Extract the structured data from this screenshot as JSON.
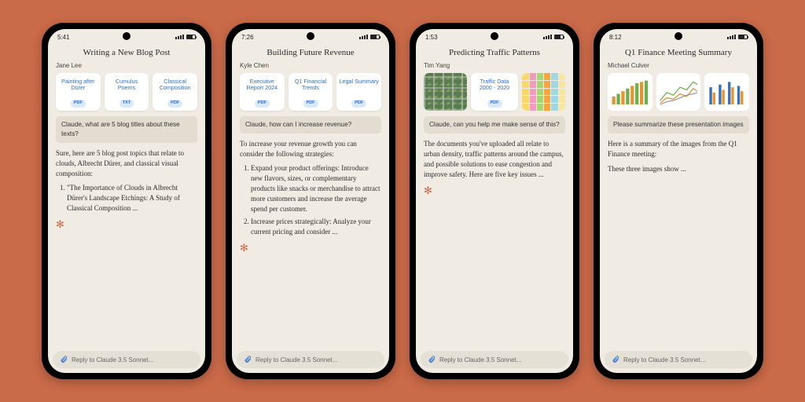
{
  "reply_placeholder": "Reply to Claude 3.5 Sonnet...",
  "phones": [
    {
      "time": "5:41",
      "title": "Writing a New Blog Post",
      "author": "Jane Lee",
      "attachments": [
        {
          "label": "Painting after Dürer",
          "badge": "PDF"
        },
        {
          "label": "Cumulus Poems",
          "badge": "TXT"
        },
        {
          "label": "Classical Composition",
          "badge": "PDF"
        }
      ],
      "user_msg": "Claude, what are 5 blog titles about these texts?",
      "resp_intro": "Sure, here are 5 blog post topics that relate to clouds, Albrecht Dürer, and classical visual composition:",
      "resp_item1": "\"The Importance of Clouds in Albrecht Dürer's Landscape Etchings: A Study of Classical Composition ..."
    },
    {
      "time": "7:26",
      "title": "Building Future Revenue",
      "author": "Kyle Chen",
      "attachments": [
        {
          "label": "Executive Report 2024",
          "badge": "PDF"
        },
        {
          "label": "Q1 Financial Trends",
          "badge": "PDF"
        },
        {
          "label": "Legal Summary",
          "badge": "PDF"
        }
      ],
      "user_msg": "Claude, how can I increase revenue?",
      "resp_intro": "To increase your revenue growth you can consider the following strategies:",
      "resp_item1": "Expand your product offerings: Introduce new flavors, sizes, or complementary products like snacks or merchandise to attract more customers and increase the average spend per customer.",
      "resp_item2": "Increase prices strategically: Analyze your current pricing and consider ..."
    },
    {
      "time": "1:53",
      "title": "Predicting Traffic Patterns",
      "author": "Tim Yang",
      "traffic_card": {
        "label": "Traffic Data 2000 - 2020",
        "badge": "PDF"
      },
      "user_msg": "Claude, can you help me make sense of this?",
      "resp_body": "The documents you've uploaded all relate to urban density, traffic patterns around the campus, and possible solutions to ease congestion and improve safety. Here are five key issues ..."
    },
    {
      "time": "8:12",
      "title": "Q1 Finance Meeting Summary",
      "author": "Michael Culver",
      "user_msg": "Please summarize these presentation images",
      "resp_line1": "Here is a summary of the images from the Q1 Finance meeting:",
      "resp_line2": "These three images show ..."
    }
  ]
}
